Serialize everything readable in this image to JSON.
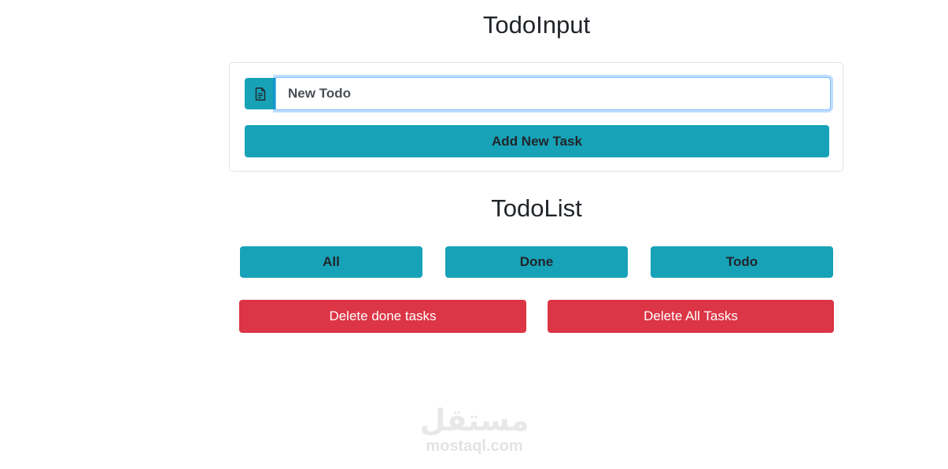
{
  "todo_input": {
    "title": "TodoInput",
    "field_value": "New Todo",
    "field_icon": "document-icon",
    "add_button_label": "Add New Task"
  },
  "todo_list": {
    "title": "TodoList",
    "filters": [
      {
        "label": "All"
      },
      {
        "label": "Done"
      },
      {
        "label": "Todo"
      }
    ],
    "delete_done_label": "Delete done tasks",
    "delete_all_label": "Delete All Tasks"
  },
  "watermark": {
    "arabic": "مستقل",
    "latin": "mostaql.com"
  },
  "colors": {
    "accent": "#17a2b8",
    "danger": "#dc3545",
    "focus_border": "#80bdff"
  }
}
